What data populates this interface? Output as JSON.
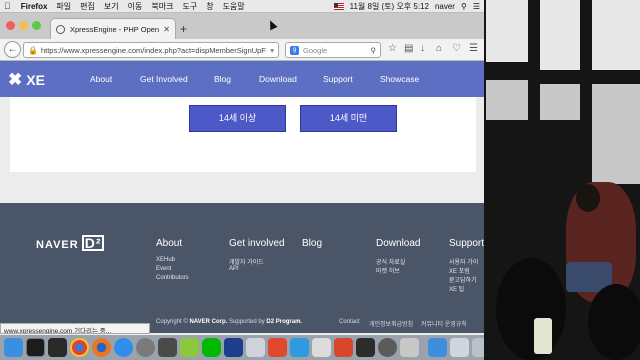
{
  "menubar": {
    "app": "Firefox",
    "items": [
      "파일",
      "편집",
      "보기",
      "이동",
      "북마크",
      "도구",
      "창",
      "도움말"
    ],
    "datetime": "11월 8일 (토) 오후 5:12",
    "user": "naver"
  },
  "tab": {
    "title": "XpressEngine - PHP Open ..."
  },
  "urlbar": {
    "url": "https://www.xpressengine.com/index.php?act=dispMemberSignUpF"
  },
  "searchbar": {
    "placeholder": "Google"
  },
  "site": {
    "logo": "XE",
    "nav": [
      "About",
      "Get Involved",
      "Blog",
      "Download",
      "Support",
      "Showcase"
    ],
    "age_over": "14세 이상",
    "age_under": "14세 미만"
  },
  "footer": {
    "brand": "NAVER",
    "brand_mark": "D²",
    "columns": [
      {
        "title": "About",
        "links": [
          "XEHub",
          "Event",
          "Contributors"
        ]
      },
      {
        "title": "Get involved",
        "links": [
          "개발자 가이드",
          "API"
        ]
      },
      {
        "title": "Blog",
        "links": []
      },
      {
        "title": "Download",
        "links": [
          "공식 자료실",
          "마켓 허브"
        ]
      },
      {
        "title": "Support",
        "links": [
          "사용자 가이",
          "XE 포럼",
          "묻고답하기",
          "XE 팁"
        ]
      }
    ],
    "copyright_prefix": "Copyright ©",
    "copyright_corp": "NAVER Corp.",
    "copyright_mid": "Supported by",
    "copyright_program": "D2 Program.",
    "bottom_links": [
      "Contact",
      "개인정보취급방침",
      "커뮤니티 운영규칙"
    ]
  },
  "status": {
    "text": "www.xpressengine.com 기다리는 중..."
  },
  "colors": {
    "site_nav": "#5d6fc2",
    "button": "#4d59c6",
    "footer": "#4a5568"
  }
}
